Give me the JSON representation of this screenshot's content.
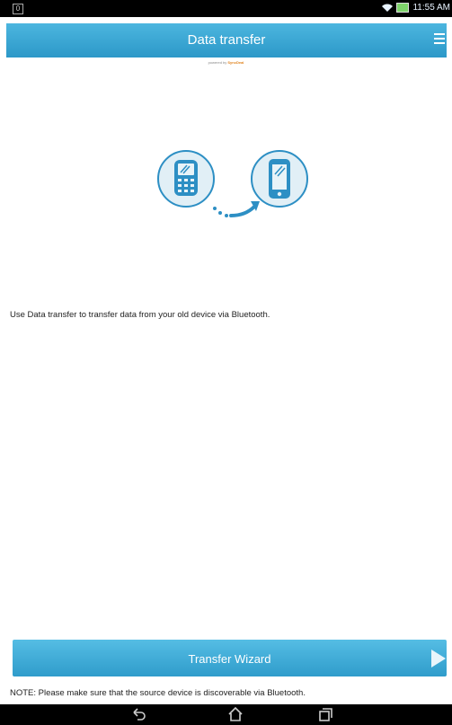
{
  "status_bar": {
    "time": "11:55 AM",
    "left_icon": "notification-icon"
  },
  "app_bar": {
    "title": "Data transfer",
    "menu_icon": "hamburger-menu-icon"
  },
  "powered_by": {
    "prefix": "powered by",
    "brand": "SyncDeal"
  },
  "illustration": {
    "icons": [
      "old-phone-icon",
      "arrow-icon",
      "new-phone-icon"
    ],
    "accent_color": "#2d8fc4"
  },
  "main": {
    "description": "Use Data transfer to transfer data from your old device via Bluetooth."
  },
  "wizard": {
    "label": "Transfer Wizard",
    "icon": "play-arrow-icon"
  },
  "note": {
    "text": "NOTE: Please make sure that the source device is discoverable via Bluetooth."
  },
  "nav_bar": {
    "buttons": [
      "back-icon",
      "home-icon",
      "recent-apps-icon"
    ]
  }
}
